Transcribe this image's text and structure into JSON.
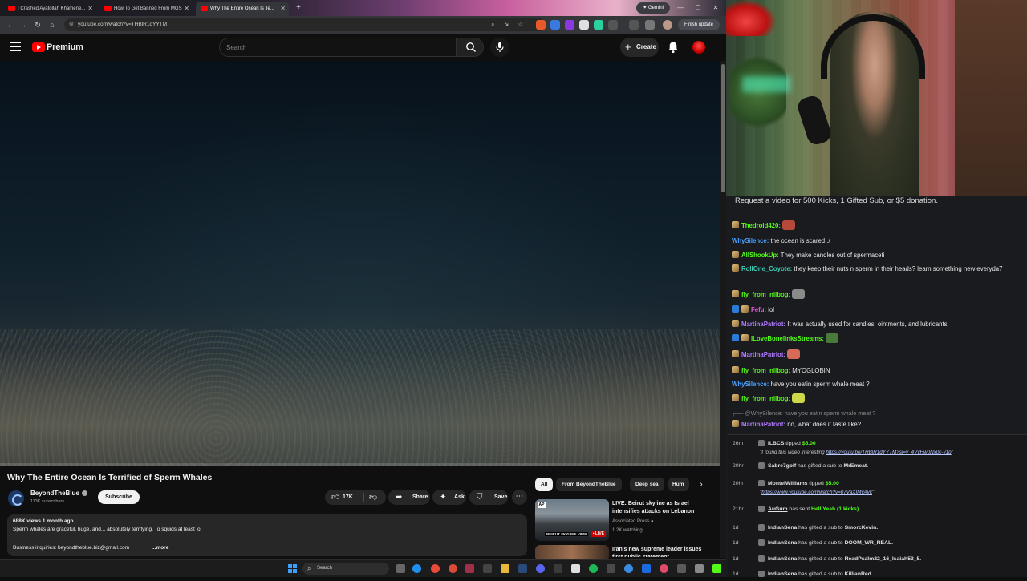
{
  "browser": {
    "tabs": [
      {
        "title": "I Crashed Ayatollah Khamene..."
      },
      {
        "title": "How To Get Banned From MGS"
      },
      {
        "title": "Why The Entire Ocean Is Te..."
      }
    ],
    "gemini_label": "Gemini",
    "url": "youtube.com/watch?v=THBlR1dYYTM",
    "finish_update": "Finish update"
  },
  "youtube": {
    "brand": "Premium",
    "search_placeholder": "Search",
    "create_label": "Create",
    "video": {
      "progress_fraction": 0.0,
      "title": "Why The Entire Ocean Is Terrified of Sperm Whales",
      "channel": "BeyondTheBlue",
      "subscribers": "113K subscribers",
      "subscribe_label": "Subscribe",
      "likes": "17K",
      "share_label": "Share",
      "ask_label": "Ask",
      "save_label": "Save",
      "views_date": "688K views  1 month ago",
      "description": "Sperm whales are graceful, huge, and... absolutely terrifying. To squids at least lol",
      "business": "Business inquiries: beyondtheblue.biz@gmail.com",
      "more_label": "...more"
    },
    "chips": [
      "All",
      "From BeyondTheBlue",
      "Deep sea",
      "Hum"
    ],
    "related": [
      {
        "title": "LIVE: Beirut skyline as Israel intensifies attacks on Lebanon",
        "channel": "Associated Press",
        "meta": "1.2K watching",
        "thumb_caption": "BEIRUT SKYLINE VIEW",
        "badge": "LIVE",
        "thumb_label": "AP"
      },
      {
        "title": "Iran's new supreme leader issues first public statement"
      }
    ]
  },
  "taskbar": {
    "search_label": "Search"
  },
  "stream": {
    "banner": "Request a video for 500 Kicks, 1 Gifted Sub, or $5 donation.",
    "messages": [
      {
        "user": "Thedroid420:",
        "text": "",
        "color": "#53fc18",
        "emote": "#b54a3a"
      },
      {
        "user": "WhySilence:",
        "text": "the ocean is scared ./",
        "color": "#4aa3ff"
      },
      {
        "user": "AllShookUp:",
        "text": "They make candles out of spermaceti",
        "color": "#53fc18"
      },
      {
        "user": "RollOne_Coyote:",
        "text": "they keep their nuts n sperm in their heads? learn something new everyda7",
        "color": "#3ec9b5"
      },
      {
        "user": "fly_from_nilbog:",
        "text": "",
        "color": "#53fc18",
        "emote": "#8a8a8a"
      },
      {
        "user": "Fefu:",
        "text": "lol",
        "color": "#e85ad8"
      },
      {
        "user": "MartinaPatriot:",
        "text": "It was actually used for candles, ointments, and lubricants.",
        "color": "#b07aff"
      },
      {
        "user": "ILoveBonelinksStreams:",
        "text": "",
        "color": "#53fc18",
        "emote": "#4a7a3a"
      },
      {
        "user": "MartinaPatriot:",
        "text": "",
        "color": "#b07aff",
        "emote": "#d86a5a"
      },
      {
        "user": "fly_from_nilbog:",
        "text": "MYOGLOBIN",
        "color": "#53fc18"
      },
      {
        "user": "WhySilence:",
        "text": "have you eatin sperm whale meat ?",
        "color": "#4aa3ff"
      },
      {
        "user": "fly_from_nilbog:",
        "text": "",
        "color": "#53fc18",
        "emote": "#cfd84a"
      },
      {
        "user": "MartinaPatriot:",
        "text": "no, what does it taste like?",
        "color": "#b07aff"
      }
    ],
    "reply_context": "@WhySilence: have you eatin sperm whale meat ?",
    "events": [
      {
        "time": "26m",
        "user": "ILBCS",
        "action": "tipped",
        "amount": "$5.00",
        "quote": "\"I found this video interesting ",
        "link": "https://youtu.be/THBlR1dYYTM?si=v_4VvHw0Nx0c-y1p",
        "quote_end": "\""
      },
      {
        "time": "20hr",
        "user": "Sabre7golf",
        "action": "has gifted a sub to",
        "target": "MrEmeat."
      },
      {
        "time": "20hr",
        "user": "MontelWilliams",
        "action": "tipped",
        "amount": "$5.00",
        "quote": "\"",
        "link": "https://www.youtube.com/watch?v=07VaXIMvAvk",
        "quote_end": "\""
      },
      {
        "time": "21hr",
        "user": "AuGum",
        "action": "has sent",
        "amount": "Hell Yeah (1 kicks)"
      },
      {
        "time": "1d",
        "user": "IndianSena",
        "action": "has gifted a sub to",
        "target": "SmorcKevin."
      },
      {
        "time": "1d",
        "user": "IndianSena",
        "action": "has gifted a sub to",
        "target": "DOOM_WR_REAL."
      },
      {
        "time": "1d",
        "user": "IndianSena",
        "action": "has gifted a sub to",
        "target": "ReadPsalm22_16_Isaiah53_5."
      },
      {
        "time": "1d",
        "user": "IndianSena",
        "action": "has gifted a sub to",
        "target": "KillianRed"
      }
    ]
  }
}
